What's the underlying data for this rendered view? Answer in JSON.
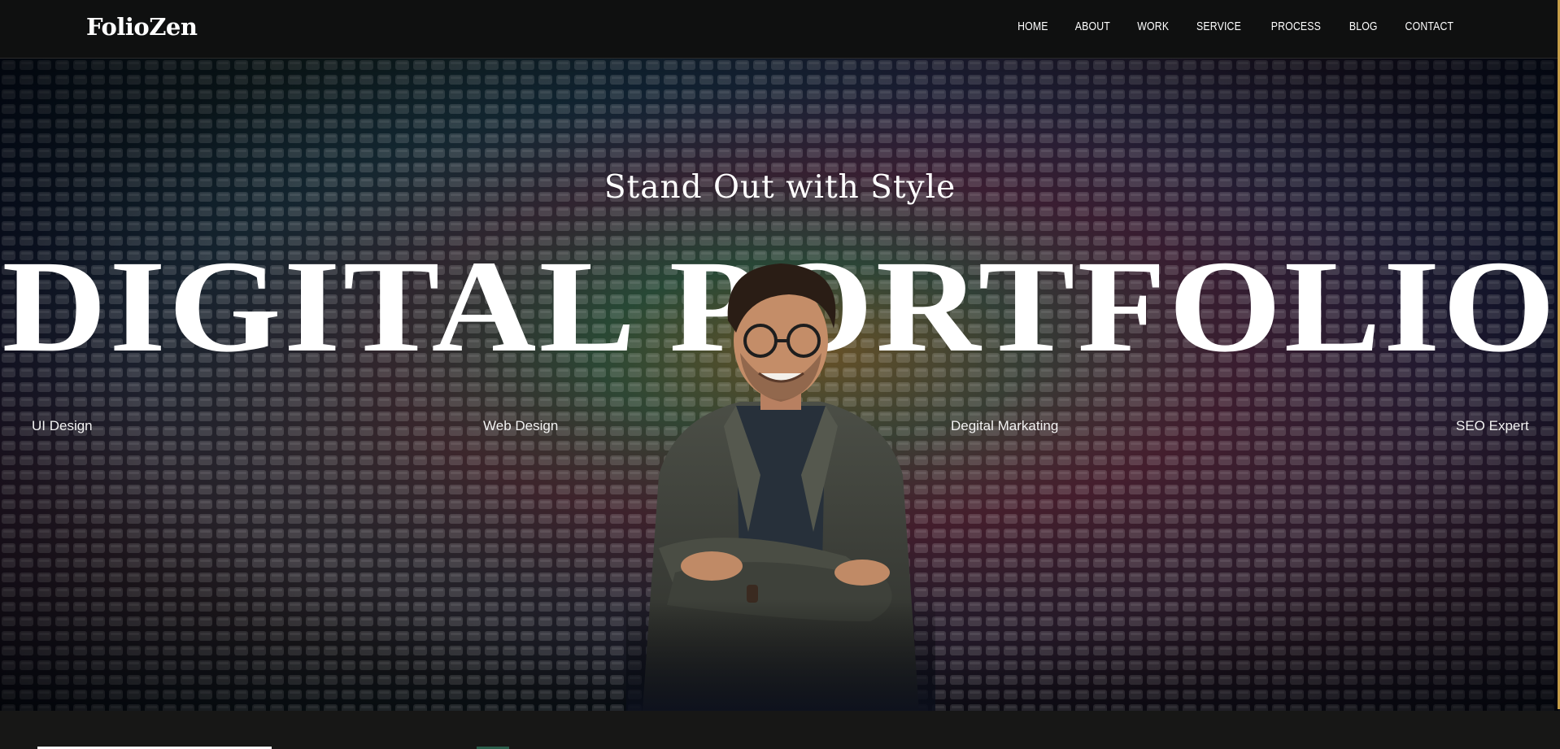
{
  "header": {
    "logo": "FolioZen",
    "nav": [
      "HOME",
      "ABOUT",
      "WORK",
      "SERVICE",
      "PROCESS",
      "BLOG",
      "CONTACT"
    ]
  },
  "hero": {
    "subtitle": "Stand Out with Style",
    "title": "DIGITAL PORTFOLIO",
    "skills": [
      "UI Design",
      "Web Design",
      "Degital Markating",
      "SEO Expert"
    ]
  },
  "colors": {
    "nav_bg": "#0f1010",
    "accent": "#c9a04a",
    "text": "#ffffff"
  }
}
